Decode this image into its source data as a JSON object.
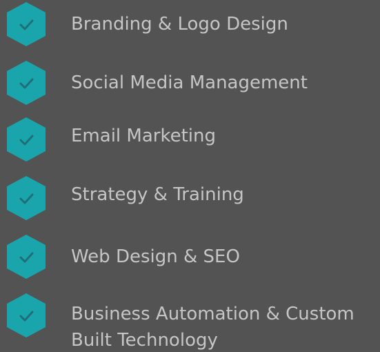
{
  "colors": {
    "background": "#535353",
    "badge": "#1aa5ad",
    "check": "#1e6f78",
    "text": "#c6c6c6"
  },
  "icon": "check-hexagon-icon",
  "items": [
    {
      "label": "Branding & Logo Design"
    },
    {
      "label": "Social Media Management"
    },
    {
      "label": "Email Marketing"
    },
    {
      "label": "Strategy & Training"
    },
    {
      "label": "Web Design & SEO"
    },
    {
      "label": "Business Automation & Custom Built Technology"
    }
  ]
}
